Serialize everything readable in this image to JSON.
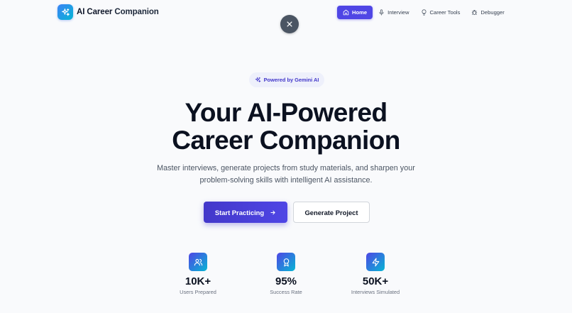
{
  "brand": {
    "title_first": "AI Career",
    "title_second": "Companion",
    "icon": "sparkles-icon"
  },
  "overlay": {
    "close_icon": "close-icon"
  },
  "nav": {
    "items": [
      {
        "label": "Home",
        "icon": "home-icon",
        "active": true
      },
      {
        "label": "Interview",
        "icon": "microphone-icon",
        "active": false
      },
      {
        "label": "Career Tools",
        "icon": "lightbulb-icon",
        "active": false
      },
      {
        "label": "Debugger",
        "icon": "bug-icon",
        "active": false
      }
    ]
  },
  "hero": {
    "badge": "Powered by Gemini AI",
    "title_line1": "Your AI-Powered",
    "title_line2": "Career Companion",
    "subtitle_line1": "Master interviews, generate projects from study materials, and sharpen your",
    "subtitle_line2": "problem-solving skills with intelligent AI assistance.",
    "primary_button": "Start Practicing",
    "secondary_button": "Generate Project"
  },
  "stats": [
    {
      "value": "10K+",
      "label": "Users Prepared",
      "icon": "users-icon"
    },
    {
      "value": "95%",
      "label": "Success Rate",
      "icon": "award-icon"
    },
    {
      "value": "50K+",
      "label": "Interviews Simulated",
      "icon": "lightning-icon"
    }
  ],
  "colors": {
    "accent": "#4f46e5",
    "gradient_start": "#4f46e5",
    "gradient_end": "#06b6d4",
    "background": "#f9fafc",
    "close_button": "#4b5563"
  }
}
